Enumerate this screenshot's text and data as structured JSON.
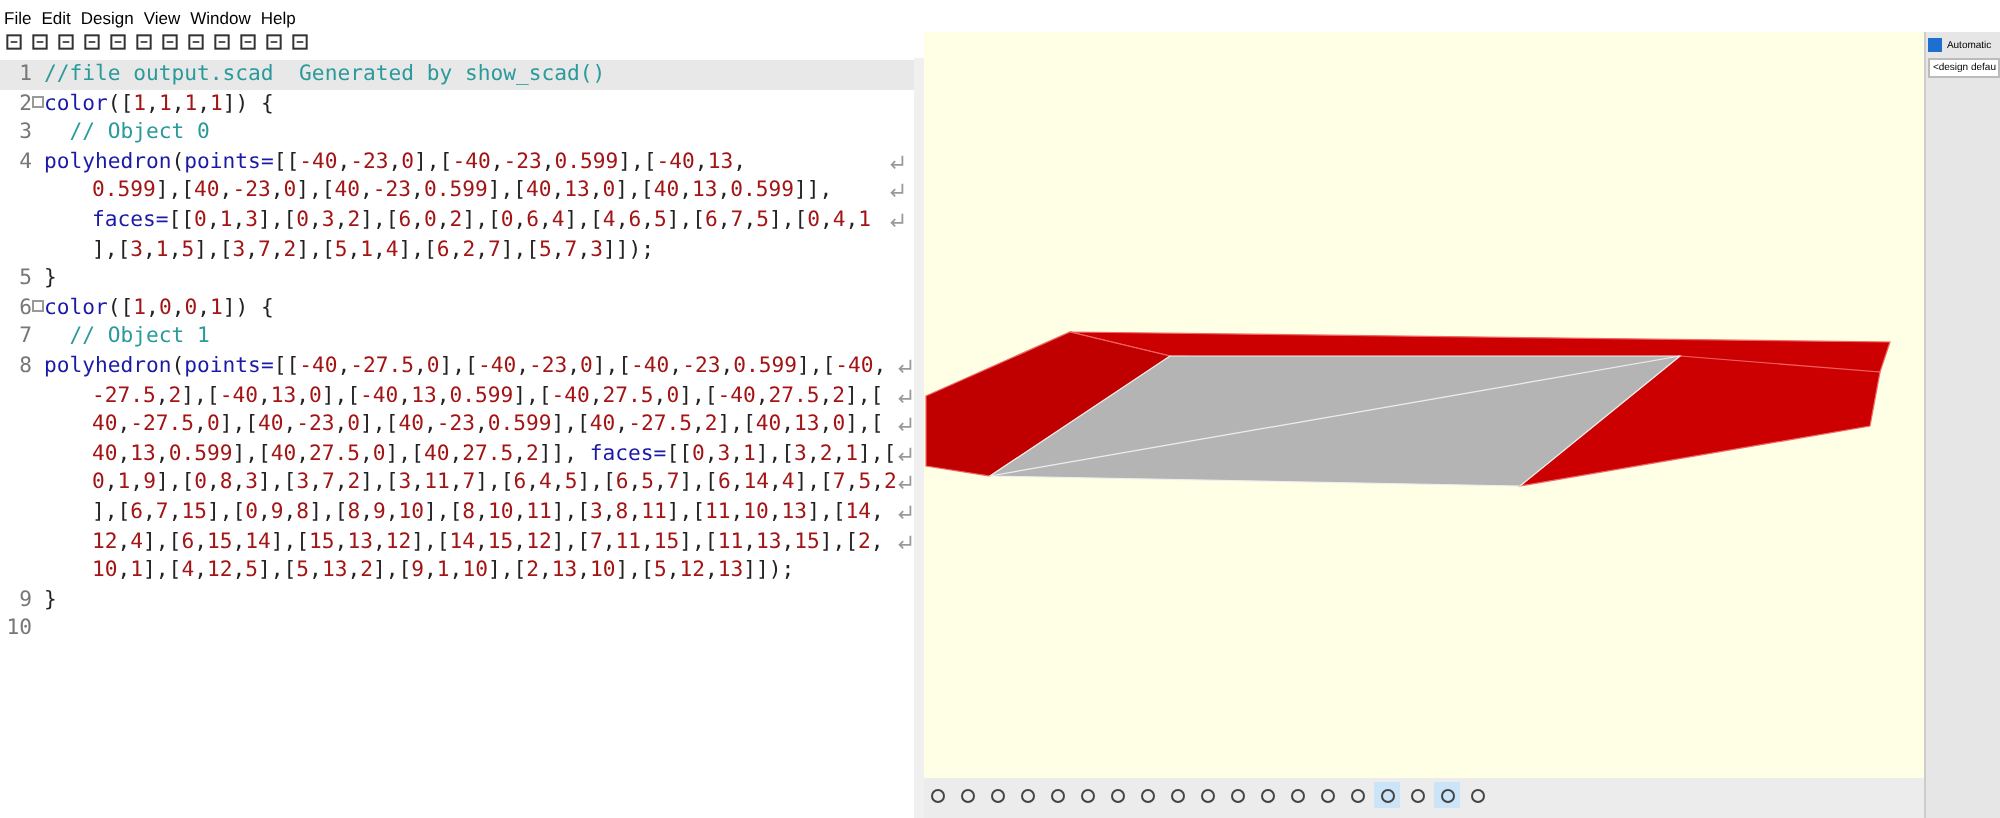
{
  "menu": [
    "File",
    "Edit",
    "Design",
    "View",
    "Window",
    "Help"
  ],
  "editor": {
    "lines": [
      {
        "number": "1",
        "kind": "comment",
        "current": true,
        "fold": false,
        "rows": [
          "//file output.scad  Generated by show_scad()"
        ]
      },
      {
        "number": "2",
        "kind": "code",
        "current": false,
        "fold": true,
        "rows": [
          "color([1,1,1,1]) {"
        ]
      },
      {
        "number": "3",
        "kind": "comment",
        "current": false,
        "fold": false,
        "rows": [
          "  // Object 0"
        ]
      },
      {
        "number": "4",
        "kind": "code",
        "current": false,
        "fold": false,
        "rows": [
          "polyhedron(points=[[-40,-23,0],[-40,-23,0.599],[-40,13,",
          "0.599],[40,-23,0],[40,-23,0.599],[40,13,0],[40,13,0.599]],",
          "faces=[[0,1,3],[0,3,2],[6,0,2],[0,6,4],[4,6,5],[6,7,5],[0,4,1",
          "],[3,1,5],[3,7,2],[5,1,4],[6,2,7],[5,7,3]]);"
        ]
      },
      {
        "number": "5",
        "kind": "code",
        "current": false,
        "fold": false,
        "rows": [
          "}"
        ]
      },
      {
        "number": "6",
        "kind": "code",
        "current": false,
        "fold": true,
        "rows": [
          "color([1,0,0,1]) {"
        ]
      },
      {
        "number": "7",
        "kind": "comment",
        "current": false,
        "fold": false,
        "rows": [
          "  // Object 1"
        ]
      },
      {
        "number": "8",
        "kind": "code",
        "current": false,
        "fold": false,
        "rows": [
          "polyhedron(points=[[-40,-27.5,0],[-40,-23,0],[-40,-23,0.599],[-40,",
          "-27.5,2],[-40,13,0],[-40,13,0.599],[-40,27.5,0],[-40,27.5,2],[",
          "40,-27.5,0],[40,-23,0],[40,-23,0.599],[40,-27.5,2],[40,13,0],[",
          "40,13,0.599],[40,27.5,0],[40,27.5,2]], faces=[[0,3,1],[3,2,1],[",
          "0,1,9],[0,8,3],[3,7,2],[3,11,7],[6,4,5],[6,5,7],[6,14,4],[7,5,2",
          "],[6,7,15],[0,9,8],[8,9,10],[8,10,11],[3,8,11],[11,10,13],[14,",
          "12,4],[6,15,14],[15,13,12],[14,15,12],[7,11,15],[11,13,15],[2,",
          "10,1],[4,12,5],[5,13,2],[9,1,10],[2,13,10],[5,12,13]]);"
        ]
      },
      {
        "number": "9",
        "kind": "code",
        "current": false,
        "fold": false,
        "rows": [
          "}"
        ]
      },
      {
        "number": "10",
        "kind": "code",
        "current": false,
        "fold": false
      }
    ]
  },
  "viewer_toolbar": [
    {
      "selected": false
    },
    {
      "selected": false
    },
    {
      "selected": false
    },
    {
      "selected": false
    },
    {
      "selected": false
    },
    {
      "selected": false
    },
    {
      "selected": false
    },
    {
      "selected": false
    },
    {
      "selected": false
    },
    {
      "selected": false
    },
    {
      "selected": false
    },
    {
      "selected": false
    },
    {
      "selected": false
    },
    {
      "selected": false
    },
    {
      "selected": false
    },
    {
      "selected": true
    },
    {
      "selected": false
    },
    {
      "selected": true
    },
    {
      "selected": false
    }
  ],
  "side_panel": {
    "automatic": {
      "label": "Automatic",
      "checked": true
    },
    "preset": {
      "value": "<design defau"
    }
  }
}
